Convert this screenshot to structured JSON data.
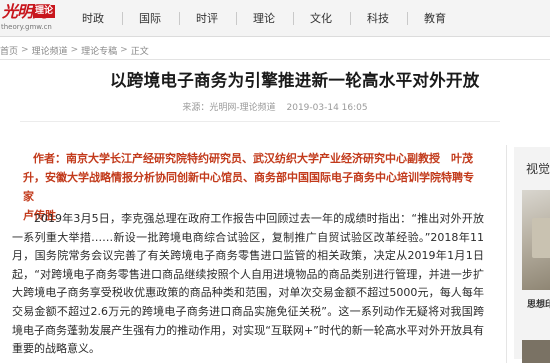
{
  "header": {
    "logo_mark": "光明网",
    "logo_badge": "理论",
    "logo_url": "theory.gmw.cn",
    "nav": [
      {
        "label": "时政"
      },
      {
        "label": "国际"
      },
      {
        "label": "时评"
      },
      {
        "label": "理论"
      },
      {
        "label": "文化"
      },
      {
        "label": "科技"
      },
      {
        "label": "教育"
      }
    ]
  },
  "breadcrumb": {
    "items": [
      "首页",
      "理论频道",
      "理论专稿",
      "正文"
    ],
    "separator": ">"
  },
  "article": {
    "title": "以跨境电子商务为引擎推进新一轮高水平对外开放",
    "source": "来源：光明网-理论频道",
    "date": "2019-03-14 16:05",
    "author_lines": [
      "作者：南京大学长江产经研究院特约研究员、武汉纺织大学产业经济研究中心副教授　叶茂",
      "升，安徽大学战略情报分析协同创新中心馆员、商务部中国国际电子商务中心培训学院特聘专家",
      "卢传胜"
    ],
    "paragraph_1": "2019年3月5日，李克强总理在政府工作报告中回顾过去一年的成绩时指出：“推出对外开放一系列重大举措……新设一批跨境电商综合试验区，复制推广自贸试验区改革经验。”2018年11月，国务院常务会议完善了有关跨境电子商务零售进口监管的相关政策，决定从2019年1月1日起，“对跨境电子商务零售进口商品继续按照个人自用进境物品的商品类别进行管理，并进一步扩大跨境电子商务享受税收优惠政策的商品种类和范围，对单次交易金额不超过5000元，每人每年交易金额不超过2.6万元的跨境电子商务进口商品实施免征关税”。这一系列动作无疑将对我国跨境电子商务蓬勃发展产生强有力的推动作用，对实现“互联网+”时代的新一轮高水平对外开放具有重要的战略意义。"
  },
  "sidebar": {
    "heading": "视觉",
    "caption": "思想印"
  },
  "colors": {
    "brand_red": "#c8161d",
    "author_red": "#c23a1b",
    "nav_bg": "#f4f4f4"
  }
}
